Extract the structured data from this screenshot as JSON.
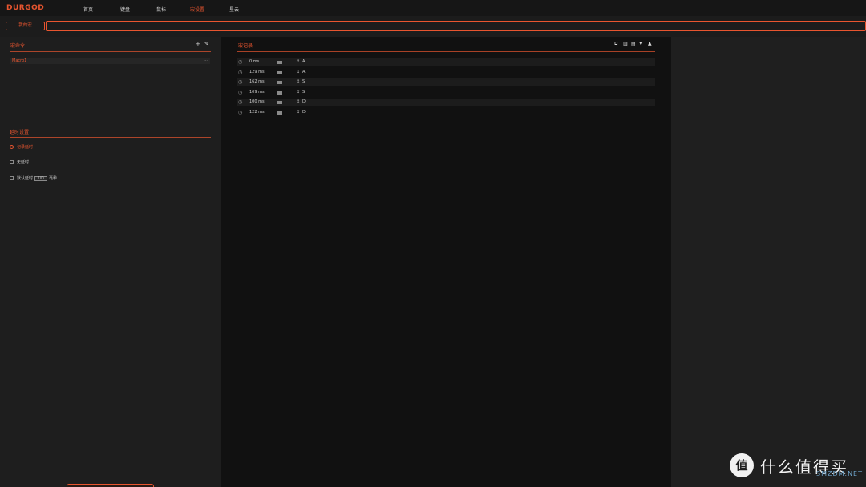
{
  "brand": "DURGOD",
  "nav": [
    {
      "label": "首页",
      "active": false
    },
    {
      "label": "键盘",
      "active": false
    },
    {
      "label": "鼠标",
      "active": false
    },
    {
      "label": "宏设置",
      "active": true
    },
    {
      "label": "星云",
      "active": false
    }
  ],
  "subbar": {
    "my_macro_label": "我的宏"
  },
  "macro_commands": {
    "title": "宏命令",
    "add_icon": "plus-icon",
    "edit_icon": "pen-icon",
    "items": [
      {
        "name": "Macro1",
        "more": "···"
      }
    ]
  },
  "delay_settings": {
    "title": "延时设置",
    "options": [
      {
        "label": "记录延时",
        "type": "radio",
        "selected": true
      },
      {
        "label": "无延时",
        "type": "checkbox",
        "selected": false
      },
      {
        "label_before": "默认延时",
        "value": "100",
        "label_after": "毫秒",
        "type": "checkbox",
        "selected": false
      }
    ]
  },
  "macro_record": {
    "title": "宏记录",
    "toolbar_icons": [
      "copy-icon",
      "delete-icon",
      "clear-icon",
      "move-down-icon",
      "move-up-icon"
    ],
    "rows": [
      {
        "time": "0 ms",
        "arrow": "↥",
        "key": "A"
      },
      {
        "time": "129 ms",
        "arrow": "↧",
        "key": "A"
      },
      {
        "time": "162 ms",
        "arrow": "↥",
        "key": "S"
      },
      {
        "time": "109 ms",
        "arrow": "↧",
        "key": "S"
      },
      {
        "time": "100 ms",
        "arrow": "↥",
        "key": "D"
      },
      {
        "time": "122 ms",
        "arrow": "↧",
        "key": "D"
      }
    ]
  },
  "watermark": {
    "badge": "值",
    "text": "什么值得买",
    "sub": "SMZDM.NET"
  },
  "colors": {
    "accent": "#e8552f",
    "background": "#141414"
  }
}
